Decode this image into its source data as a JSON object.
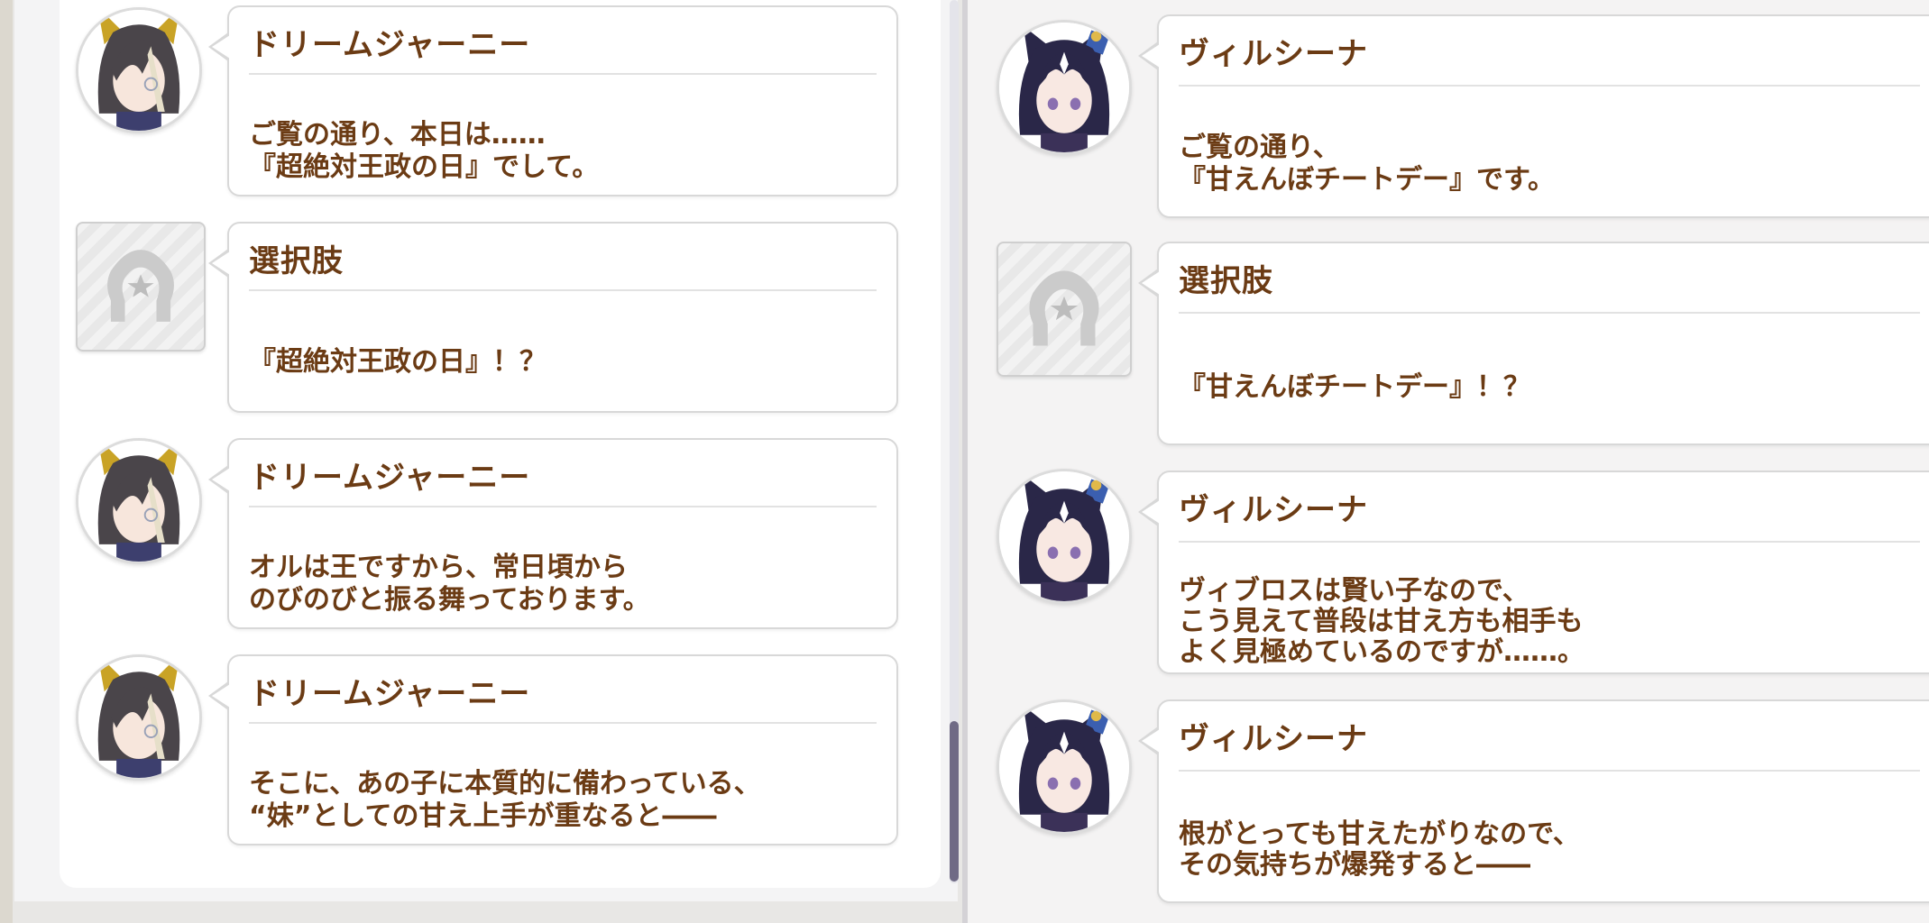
{
  "colors": {
    "text_brown": "#6b3b14",
    "bubble_bg": "#ffffff",
    "bubble_border": "#d8d8d8",
    "scroll_thumb": "#6f6a85",
    "panel_bg": "#f4f4f5"
  },
  "left_log": [
    {
      "speaker": "ドリームジャーニー",
      "lines": [
        "ご覧の通り、本日は……",
        "『超絶対王政の日』でして。"
      ],
      "avatar": "dream-journey-avatar-icon"
    },
    {
      "speaker": "選択肢",
      "lines": [
        "『超絶対王政の日』！？"
      ],
      "avatar": "horseshoe-choice-icon"
    },
    {
      "speaker": "ドリームジャーニー",
      "lines": [
        "オルは王ですから、常日頃から",
        "のびのびと振る舞っております。"
      ],
      "avatar": "dream-journey-avatar-icon"
    },
    {
      "speaker": "ドリームジャーニー",
      "lines": [
        "そこに、あの子に本質的に備わっている、",
        "“妹”としての甘え上手が重なると――"
      ],
      "avatar": "dream-journey-avatar-icon"
    }
  ],
  "right_log": [
    {
      "speaker": "ヴィルシーナ",
      "lines": [
        "ご覧の通り、",
        "『甘えんぼチートデー』です。"
      ],
      "avatar": "verxina-avatar-icon"
    },
    {
      "speaker": "選択肢",
      "lines": [
        "『甘えんぼチートデー』！？"
      ],
      "avatar": "horseshoe-choice-icon"
    },
    {
      "speaker": "ヴィルシーナ",
      "lines": [
        "ヴィブロスは賢い子なので、",
        "こう見えて普段は甘え方も相手も",
        "よく見極めているのですが……。"
      ],
      "avatar": "verxina-avatar-icon"
    },
    {
      "speaker": "ヴィルシーナ",
      "lines": [
        "根がとっても甘えたがりなので、",
        "その気持ちが爆発すると――"
      ],
      "avatar": "verxina-avatar-icon"
    }
  ]
}
